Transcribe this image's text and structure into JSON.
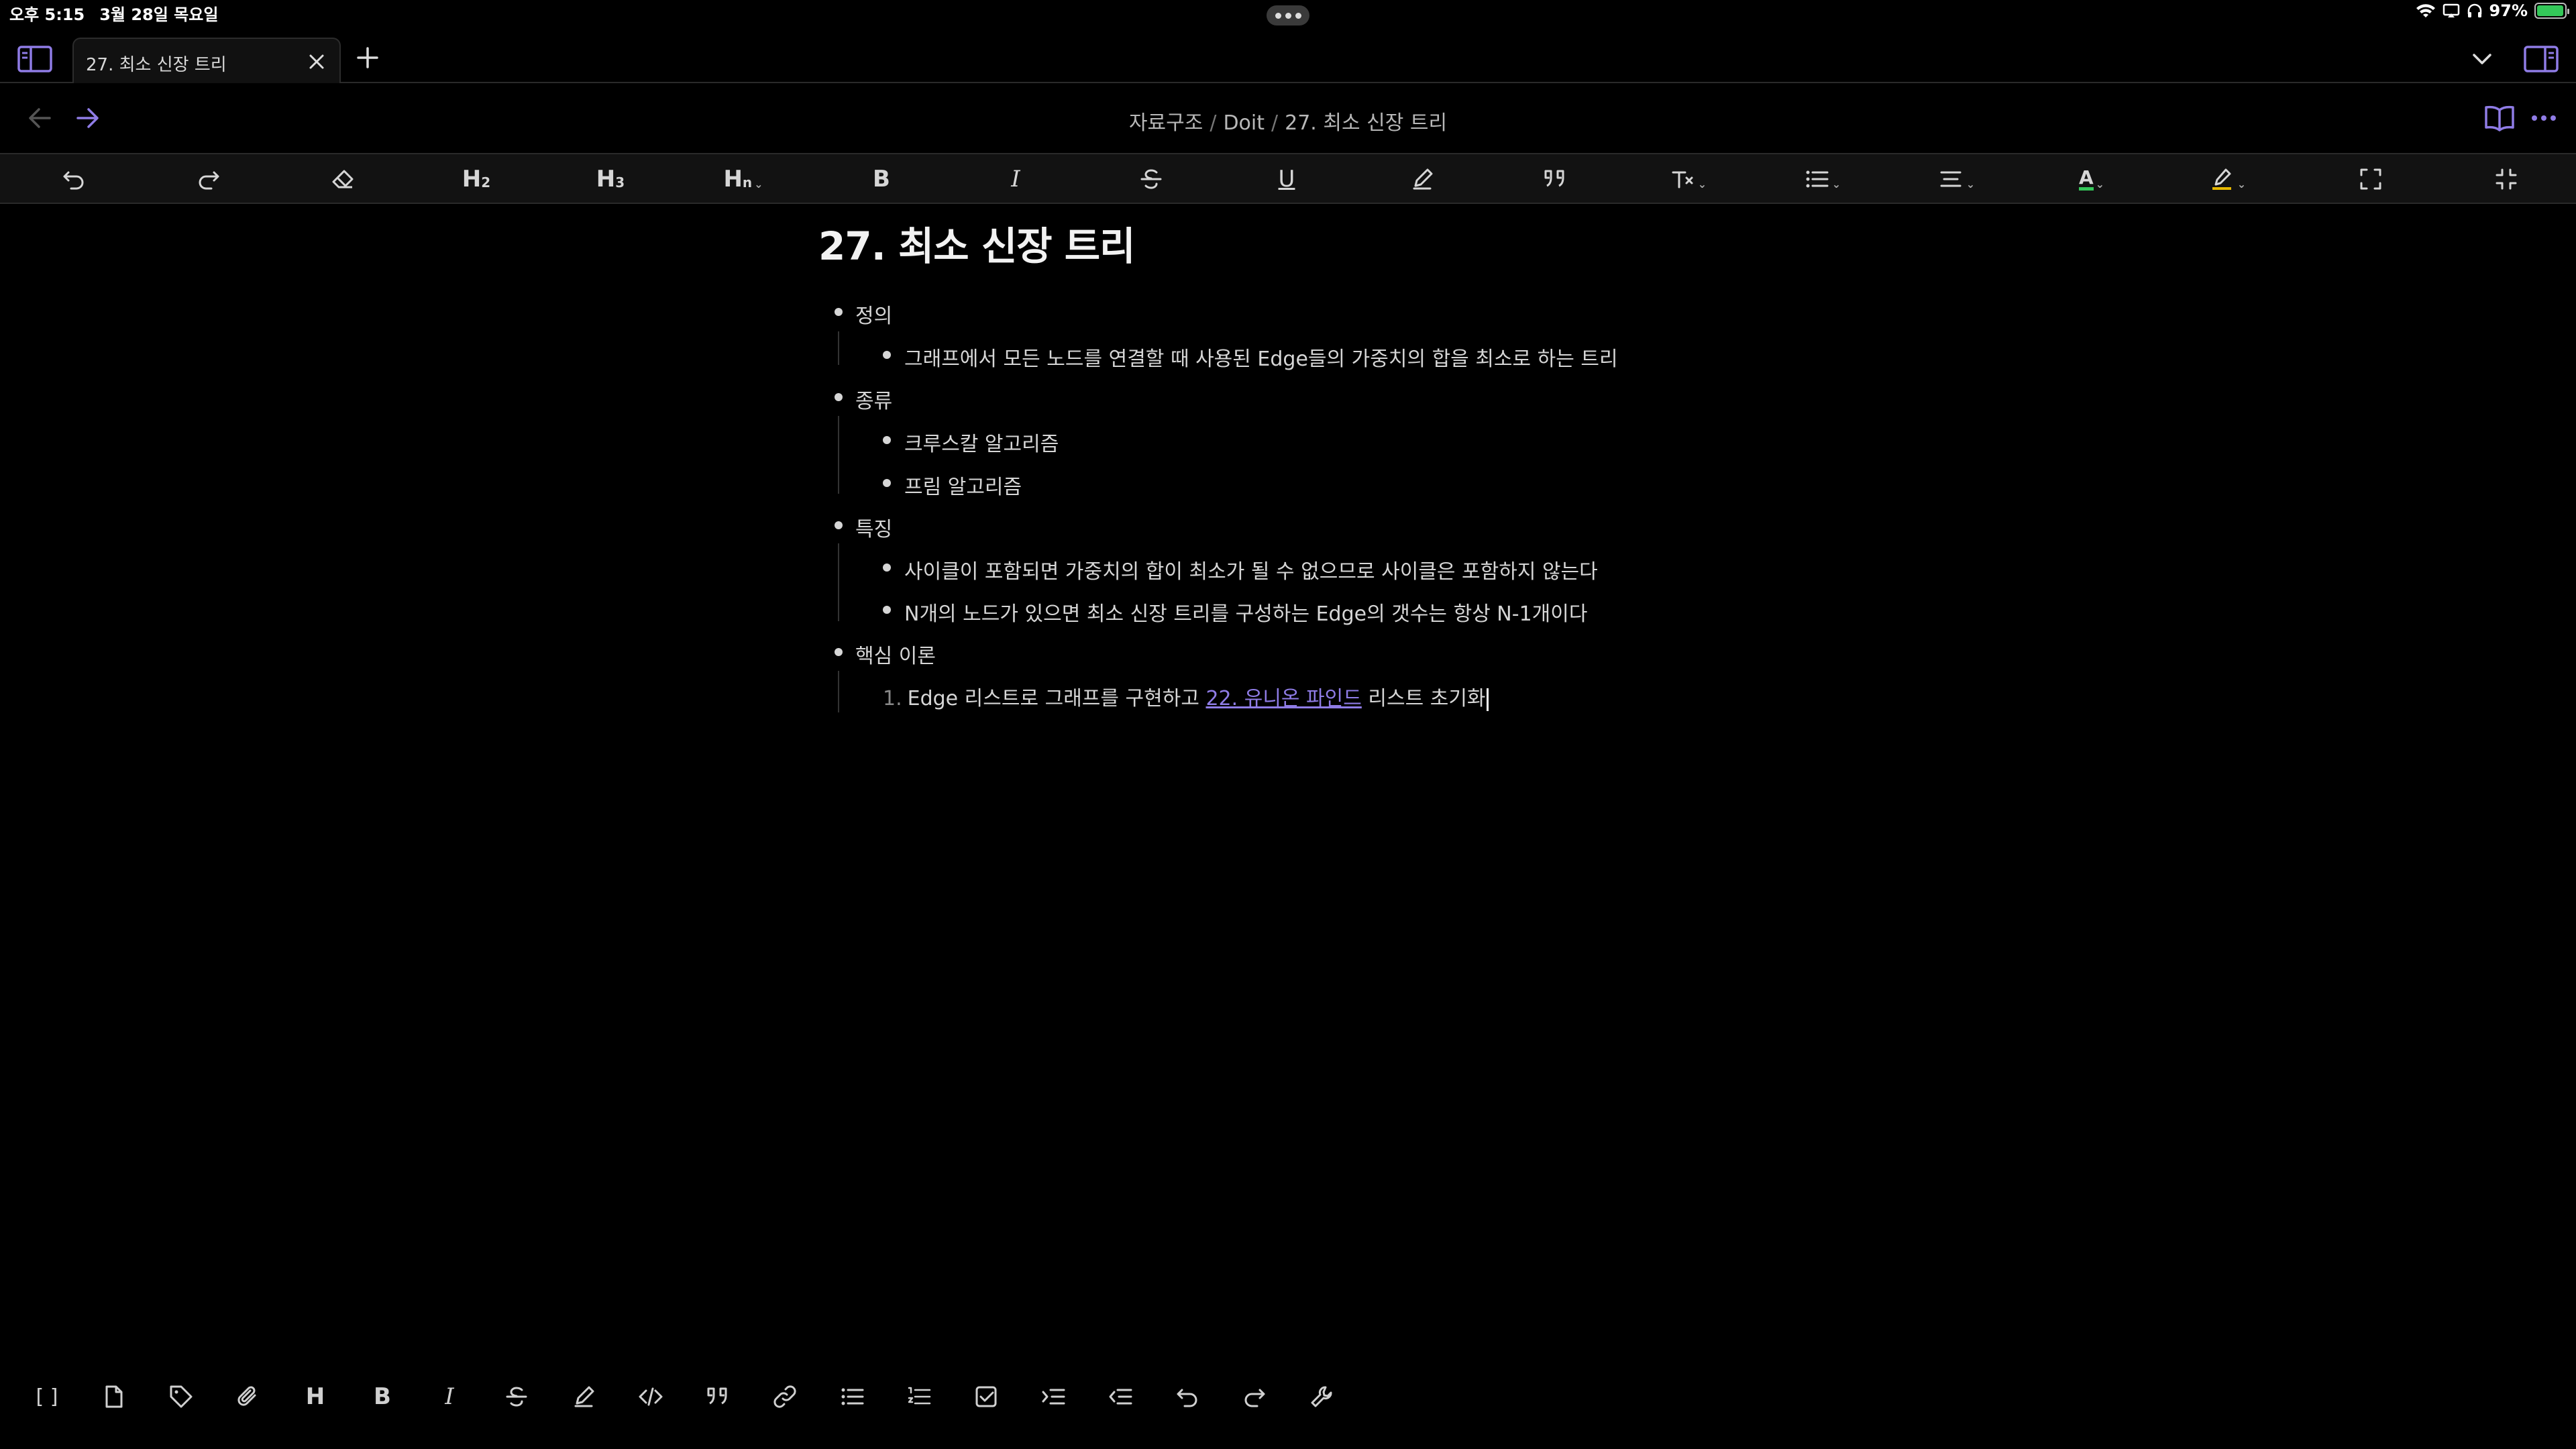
{
  "status": {
    "time": "오후 5:15",
    "date": "3월 28일 목요일",
    "battery": "97%",
    "battery_level": 0.97
  },
  "tab": {
    "title": "27. 최소 신장 트리"
  },
  "breadcrumb": {
    "parts": [
      "자료구조",
      "Doit",
      "27. 최소 신장 트리"
    ],
    "separator": "/"
  },
  "toolbar": {
    "h2": "H",
    "h2_sub": "2",
    "h3": "H",
    "h3_sub": "3",
    "hn": "H",
    "hn_sub": "n",
    "bold": "B",
    "italic": "I",
    "underline": "U",
    "text_color_letter": "A",
    "text_color": "#34c759",
    "highlight_color": "#e6b800"
  },
  "bottom_toolbar": {
    "wikilink": "[ ]",
    "heading": "H",
    "bold": "B",
    "italic": "I"
  },
  "note": {
    "title": "27. 최소 신장 트리",
    "items": [
      {
        "label": "정의",
        "children": [
          "그래프에서 모든 노드를 연결할 때 사용된 Edge들의 가중치의 합을 최소로 하는 트리"
        ]
      },
      {
        "label": "종류",
        "children": [
          "크루스칼 알고리즘",
          "프림 알고리즘"
        ]
      },
      {
        "label": "특징",
        "children": [
          "사이클이 포함되면 가중치의 합이 최소가 될 수 없으므로 사이클은 포함하지 않는다",
          "N개의 노드가 있으면 최소 신장 트리를 구성하는 Edge의 갯수는 항상 N-1개이다"
        ]
      },
      {
        "label": "핵심 이론",
        "ordered": {
          "number": "1.",
          "text_before": "Edge 리스트로 그래프를 구현하고 ",
          "link": "22. 유니온 파인드",
          "text_after": " 리스트 초기화"
        }
      }
    ]
  },
  "colors": {
    "accent": "#8f7ce6",
    "background": "#000000",
    "toolbar_bg": "#121212"
  }
}
